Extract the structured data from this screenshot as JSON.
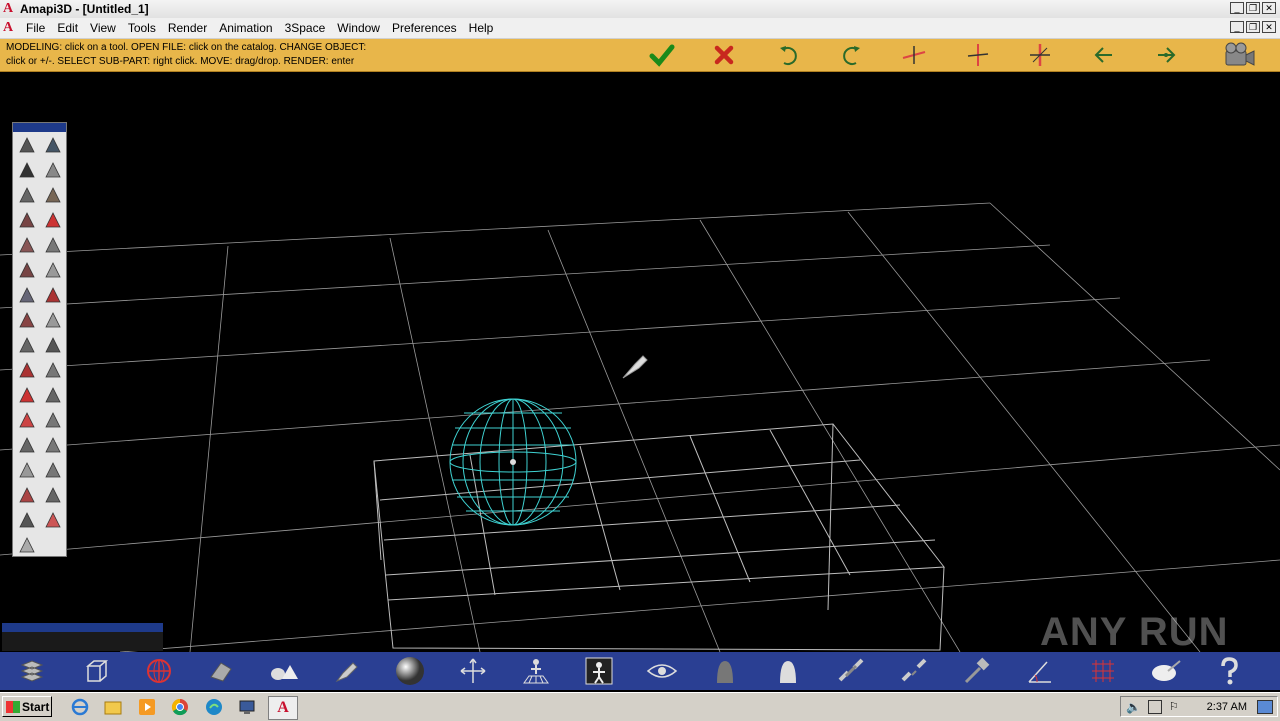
{
  "titlebar": {
    "app": "A",
    "title": "Amapi3D - [Untitled_1]"
  },
  "menubar": {
    "items": [
      "File",
      "Edit",
      "View",
      "Tools",
      "Render",
      "Animation",
      "3Space",
      "Window",
      "Preferences",
      "Help"
    ]
  },
  "status": {
    "line1": "MODELING: click on a tool. OPEN FILE: click on the catalog. CHANGE OBJECT:",
    "line2": "click or +/-. SELECT SUB-PART: right click. MOVE: drag/drop. RENDER: enter"
  },
  "toolbar_icons": [
    "checkmark-icon",
    "cancel-icon",
    "undo-icon",
    "redo-icon",
    "axis-x-icon",
    "axis-y-icon",
    "axis-z-icon",
    "arrow-left-icon",
    "arrow-right-icon",
    "camera-icon"
  ],
  "palette_tools": [
    "line-tool",
    "pen-tool",
    "text-tool",
    "sphere-tool",
    "cube-tool",
    "brush-tool",
    "extrude-tool",
    "red-cube-tool",
    "curve-tool",
    "spike-tool",
    "deform-tool",
    "plane-tool",
    "pipe-tool",
    "lattice-tool",
    "ball-tool",
    "leaf-tool",
    "knife-tool",
    "blob-tool",
    "paint-tool",
    "pyramid-tool",
    "red-shape-tool",
    "gear-tool",
    "mesh-tool",
    "box-tool",
    "mirror-tool",
    "stack-tool",
    "rotate-tool",
    "cutter-tool",
    "wire-cube-tool",
    "twist-tool",
    "down-arrow-tool",
    "grid-plane-tool",
    "line-select-tool"
  ],
  "bottom_icons": [
    "layers-icon",
    "cube-icon",
    "globe-icon",
    "hand-icon",
    "mountains-icon",
    "pen-icon",
    "sphere-icon",
    "move-icon",
    "figure-grid-icon",
    "figure-icon",
    "eye-icon",
    "ghost-icon",
    "ghost-white-icon",
    "chain-icon",
    "broken-chain-icon",
    "tool-icon",
    "angle-icon",
    "grid-icon",
    "palette-icon",
    "help-icon"
  ],
  "taskbar": {
    "start": "Start",
    "clock": "2:37 AM"
  },
  "watermark": "ANY RUN",
  "colors": {
    "status_bg": "#e8b64a",
    "bottom_bg": "#2a3f93",
    "wire": "#3fd2d2"
  }
}
